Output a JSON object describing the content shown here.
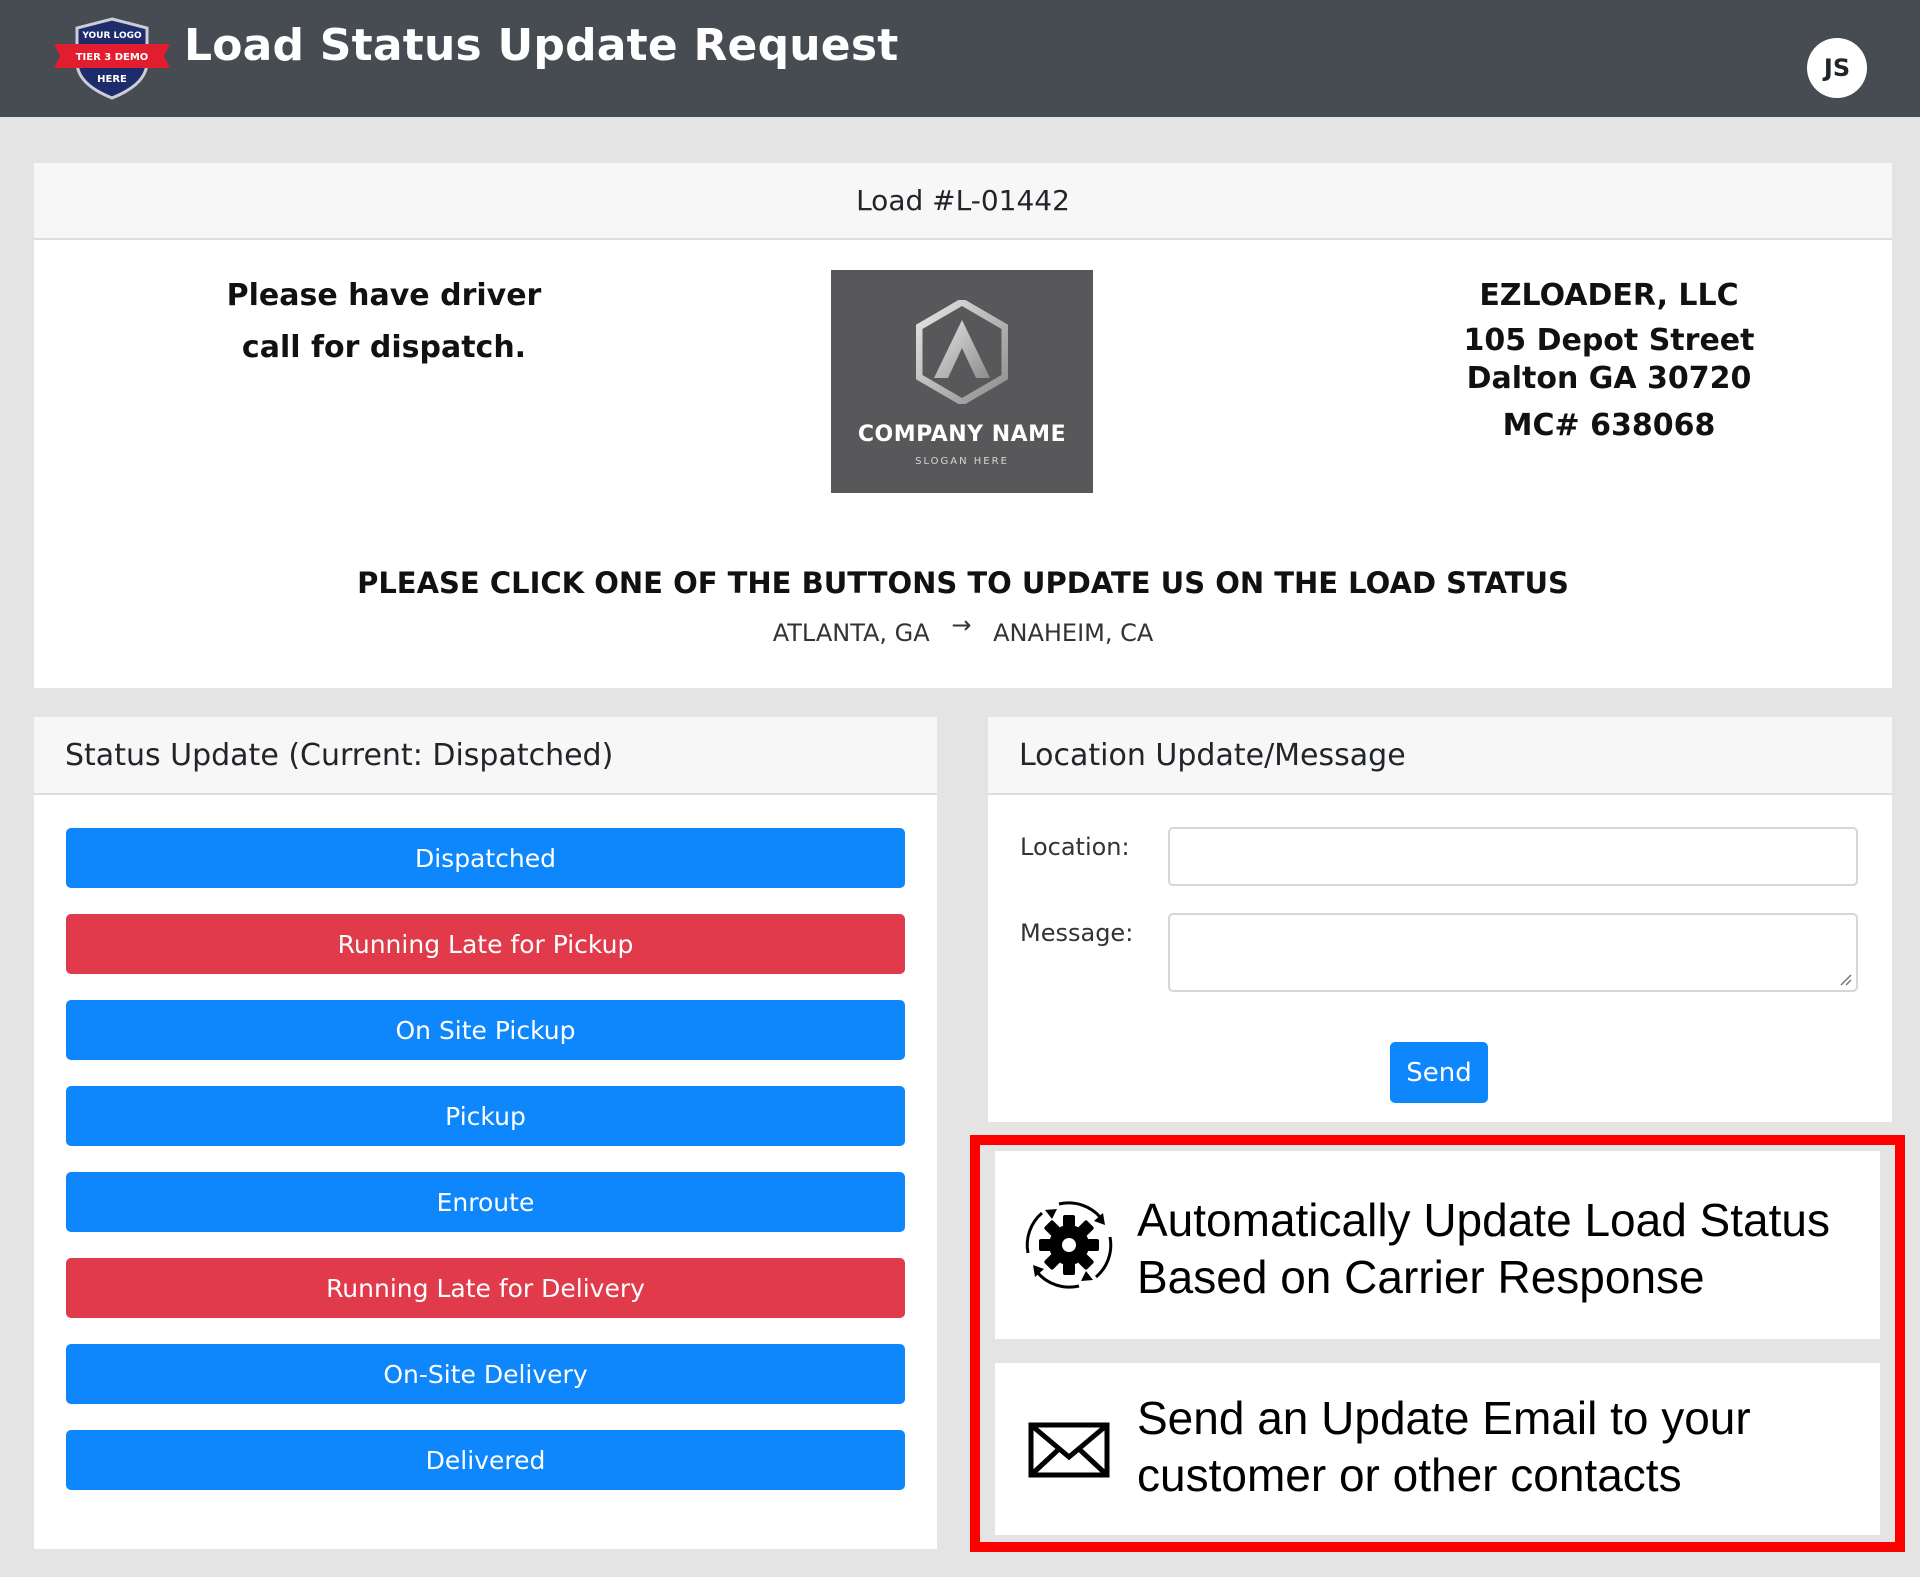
{
  "header": {
    "logo_text": [
      "YOUR LOGO",
      "TIER 3 DEMO",
      "HERE"
    ],
    "title": "Load Status Update Request",
    "avatar_initials": "JS"
  },
  "load": {
    "title": "Load #L-01442",
    "driver_note_line1": "Please have driver",
    "driver_note_line2": "call for dispatch.",
    "company_logo": {
      "name": "COMPANY NAME",
      "slogan": "SLOGAN HERE"
    },
    "carrier": {
      "name": "EZLOADER, LLC",
      "address_line1": "105 Depot Street",
      "address_line2": "Dalton GA 30720",
      "mc": "MC# 638068"
    },
    "instruction": "PLEASE CLICK ONE OF THE BUTTONS TO UPDATE US ON THE LOAD STATUS",
    "route": {
      "origin": "ATLANTA, GA",
      "arrow_icon": "arrow-right-icon",
      "destination": "ANAHEIM, CA"
    }
  },
  "status_update": {
    "header": "Status Update (Current: Dispatched)",
    "buttons": [
      {
        "label": "Dispatched",
        "color": "#0d87fb"
      },
      {
        "label": "Running Late for Pickup",
        "color": "#e03a4b"
      },
      {
        "label": "On Site Pickup",
        "color": "#0d87fb"
      },
      {
        "label": "Pickup",
        "color": "#0d87fb"
      },
      {
        "label": "Enroute",
        "color": "#0d87fb"
      },
      {
        "label": "Running Late for Delivery",
        "color": "#e03a4b"
      },
      {
        "label": "On-Site Delivery",
        "color": "#0d87fb"
      },
      {
        "label": "Delivered",
        "color": "#0d87fb"
      }
    ]
  },
  "location_update": {
    "header": "Location Update/Message",
    "location_label": "Location:",
    "location_value": "",
    "message_label": "Message:",
    "message_value": "",
    "send_label": "Send"
  },
  "features": [
    {
      "icon": "gear-sync-icon",
      "line1": "Automatically Update Load Status",
      "line2": "Based on Carrier Response"
    },
    {
      "icon": "envelope-icon",
      "line1": "Send an Update Email to your",
      "line2": "customer or other contacts"
    }
  ],
  "colors": {
    "header_bg": "#474c53",
    "primary": "#0d87fb",
    "danger": "#e03a4b",
    "highlight_border": "#ff0000",
    "page_bg": "#e4e4e4"
  }
}
